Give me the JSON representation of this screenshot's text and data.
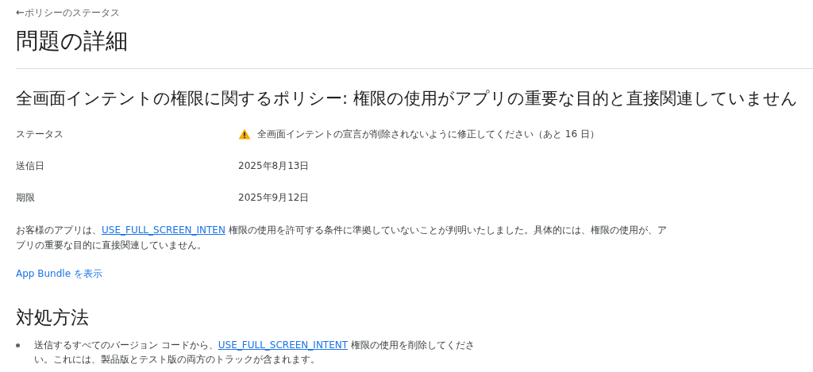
{
  "back_link": {
    "arrow": "←",
    "label": "ポリシーのステータス"
  },
  "title": "問題の詳細",
  "issue_heading": "全画面インテントの権限に関するポリシー: 権限の使用がアプリの重要な目的と直接関連していません",
  "details": [
    {
      "label": "ステータス",
      "value": "全画面インテントの宣言が削除されないように修正してください（あと 16 日）",
      "kind": "warning"
    },
    {
      "label": "送信日",
      "value": "2025年8月13日",
      "kind": "plain"
    },
    {
      "label": "期限",
      "value": "2025年9月12日",
      "kind": "plain"
    }
  ],
  "description": {
    "before": "お客様のアプリは、",
    "link": "USE_FULL_SCREEN_INTEN",
    "after": " 権限の使用を許可する条件に準拠していないことが判明いたしました。具体的には、権限の使用が、アプリの重要な目的に直接関連していません。"
  },
  "app_bundle_link": "App Bundle を表示",
  "fix_heading": "対処方法",
  "steps": [
    {
      "before": "送信するすべてのバージョン コードから、",
      "link": "USE_FULL_SCREEN_INTENT",
      "after": " 権限の使用を削除してください。これには、製品版とテスト版の両方のトラックが含まれます。"
    }
  ]
}
